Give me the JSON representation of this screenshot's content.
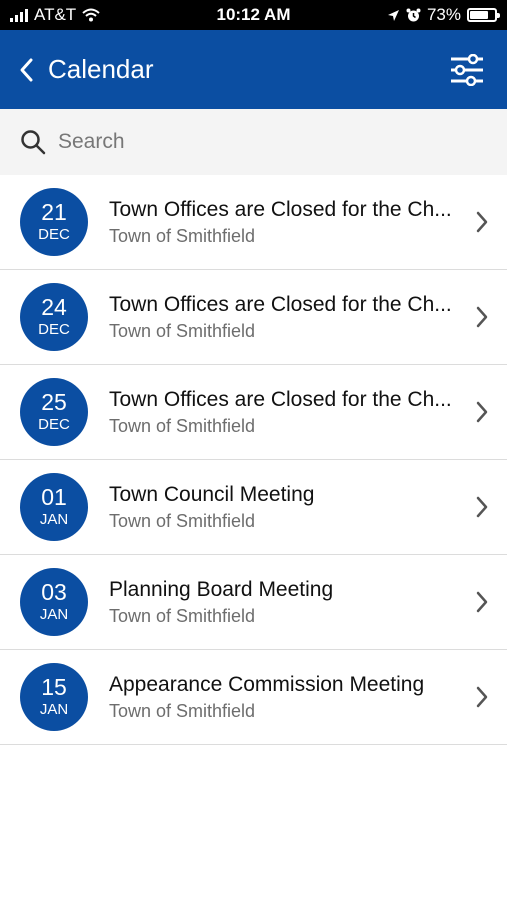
{
  "status_bar": {
    "carrier": "AT&T",
    "time": "10:12 AM",
    "battery_percent": "73%",
    "battery_level": 0.73,
    "icons": [
      "signal-icon",
      "wifi-icon",
      "location-icon",
      "alarm-icon",
      "battery-icon"
    ]
  },
  "header": {
    "title": "Calendar",
    "back_icon": "chevron-left-icon",
    "filter_icon": "sliders-icon",
    "background": "#0b4ea2"
  },
  "search": {
    "placeholder": "Search",
    "value": ""
  },
  "events": [
    {
      "day": "21",
      "month": "DEC",
      "title": "Town Offices are Closed for the Ch...",
      "organizer": "Town of Smithfield"
    },
    {
      "day": "24",
      "month": "DEC",
      "title": "Town Offices are Closed for the Ch...",
      "organizer": "Town of Smithfield"
    },
    {
      "day": "25",
      "month": "DEC",
      "title": "Town Offices are Closed for the Ch...",
      "organizer": "Town of Smithfield"
    },
    {
      "day": "01",
      "month": "JAN",
      "title": "Town Council Meeting",
      "organizer": "Town of Smithfield"
    },
    {
      "day": "03",
      "month": "JAN",
      "title": "Planning Board Meeting",
      "organizer": "Town of Smithfield"
    },
    {
      "day": "15",
      "month": "JAN",
      "title": "Appearance Commission Meeting",
      "organizer": "Town of Smithfield"
    }
  ]
}
